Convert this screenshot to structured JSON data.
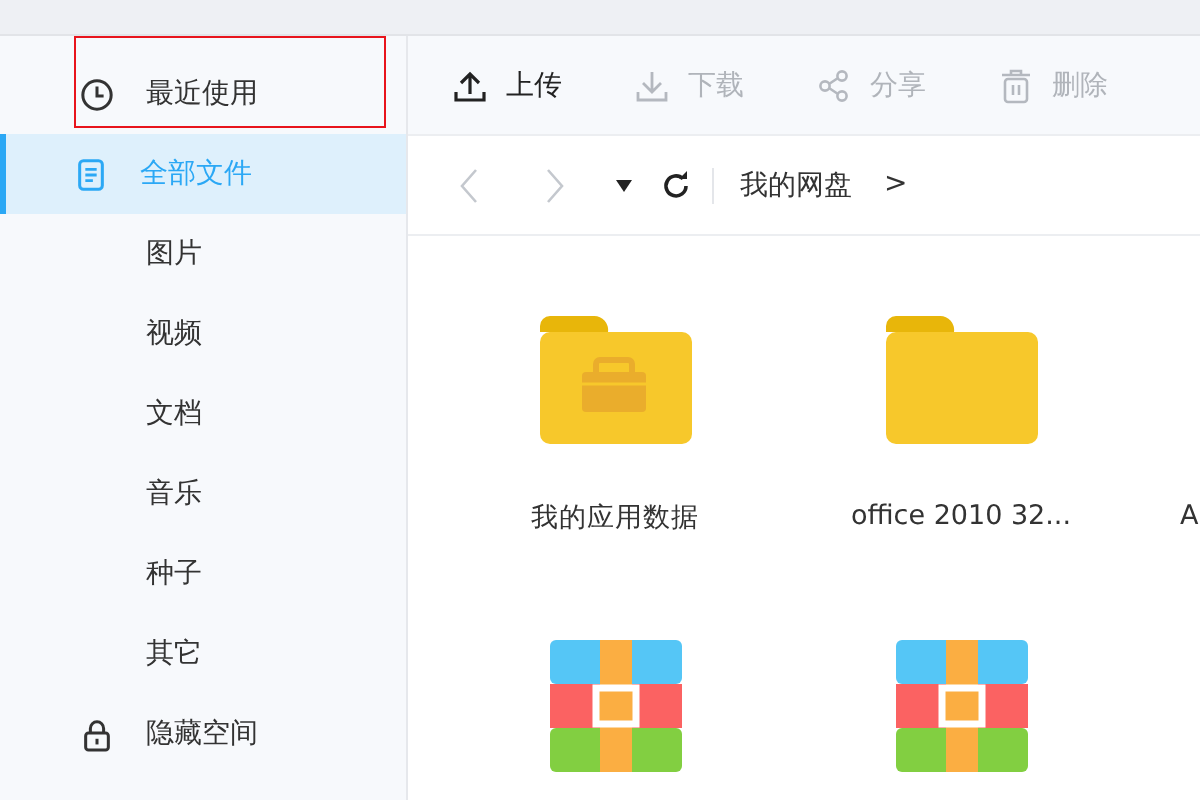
{
  "sidebar": {
    "items": [
      {
        "label": "最近使用",
        "kind": "clock",
        "selected": false
      },
      {
        "label": "全部文件",
        "kind": "document",
        "selected": true
      },
      {
        "label": "图片",
        "selected": false
      },
      {
        "label": "视频",
        "selected": false
      },
      {
        "label": "文档",
        "selected": false
      },
      {
        "label": "音乐",
        "selected": false
      },
      {
        "label": "种子",
        "selected": false
      },
      {
        "label": "其它",
        "selected": false
      },
      {
        "label": "隐藏空间",
        "kind": "lock",
        "selected": false
      }
    ]
  },
  "toolbar": [
    {
      "label": "上传",
      "kind": "upload",
      "disabled": false
    },
    {
      "label": "下载",
      "kind": "download",
      "disabled": true
    },
    {
      "label": "分享",
      "kind": "share",
      "disabled": true
    },
    {
      "label": "删除",
      "kind": "trash",
      "disabled": true
    }
  ],
  "navigation": {
    "back_disabled": true,
    "forward_disabled": true,
    "breadcrumb": [
      {
        "label": "我的网盘"
      },
      {
        "label": ">"
      }
    ]
  },
  "files": [
    {
      "name": "我的应用数据",
      "kind": "app-folder"
    },
    {
      "name": "office 2010 32...",
      "kind": "folder"
    },
    {
      "name": "A",
      "kind": "cut"
    },
    {
      "kind": "archive"
    },
    {
      "kind": "archive"
    }
  ]
}
